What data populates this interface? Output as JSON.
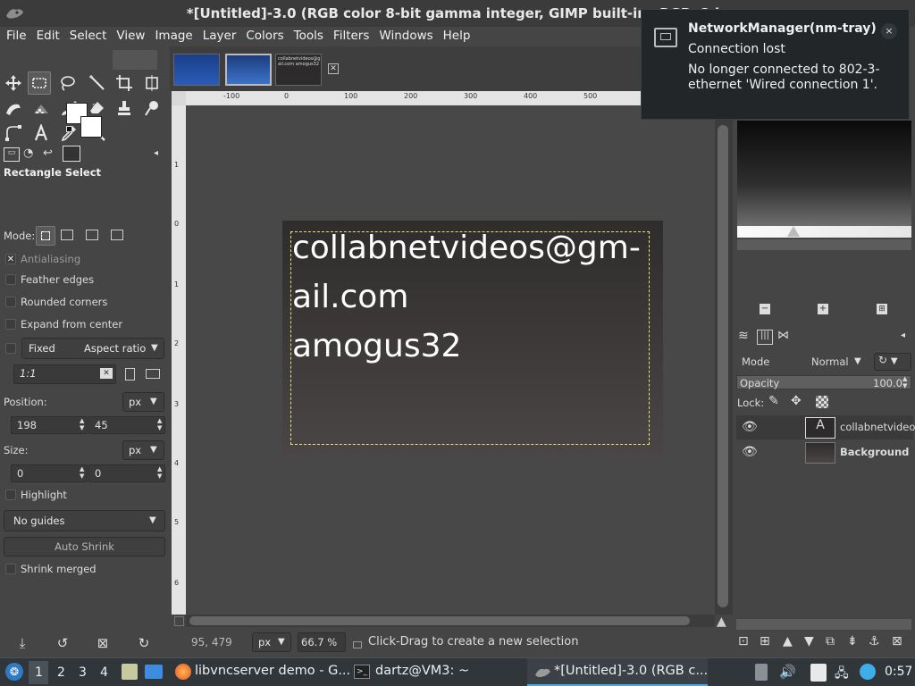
{
  "window": {
    "title": "*[Untitled]-3.0 (RGB color 8-bit gamma integer, GIMP built-in sRGB, 2 la"
  },
  "menubar": [
    "File",
    "Edit",
    "Select",
    "View",
    "Image",
    "Layer",
    "Colors",
    "Tools",
    "Filters",
    "Windows",
    "Help"
  ],
  "tool_options": {
    "title": "Rectangle Select",
    "mode_label": "Mode:",
    "antialiasing": "Antialiasing",
    "feather_edges": "Feather edges",
    "rounded_corners": "Rounded corners",
    "expand_from_center": "Expand from center",
    "fixed_label": "Fixed",
    "fixed_mode": "Aspect ratio",
    "ratio_value": "1:1",
    "position_label": "Position:",
    "position_unit": "px",
    "position_x": "198",
    "position_y": "45",
    "size_label": "Size:",
    "size_unit": "px",
    "size_w": "0",
    "size_h": "0",
    "highlight": "Highlight",
    "guides": "No guides",
    "auto_shrink": "Auto Shrink",
    "shrink_merged": "Shrink merged"
  },
  "image_thumbs": {
    "third_text": "collabnetvideos@gm-ail.com amogus32"
  },
  "ruler_labels": {
    "h": [
      "-100",
      "0",
      "100",
      "200",
      "300",
      "400",
      "500"
    ],
    "v": [
      "1",
      "0",
      "1",
      "2",
      "3",
      "4",
      "5",
      "6"
    ]
  },
  "canvas_text": {
    "line1": "collabnetvideos@gm-",
    "line2": "ail.com",
    "line3": "amogus32"
  },
  "status": {
    "coords": "95, 479",
    "unit": "px",
    "zoom": "66.7 %",
    "message": "Click-Drag to create a new selection"
  },
  "layers": {
    "mode_label": "Mode",
    "mode_value": "Normal",
    "opacity_label": "Opacity",
    "opacity_value": "100.0",
    "lock_label": "Lock:",
    "items": [
      {
        "name": "collabnetvideo"
      },
      {
        "name": "Background"
      }
    ]
  },
  "notification": {
    "title": "NetworkManager(nm-tray)",
    "subtitle": "Connection lost",
    "body": "No longer connected to 802-3-ethernet 'Wired connection 1'.",
    "close": "×"
  },
  "taskbar": {
    "workspaces": [
      "1",
      "2",
      "3",
      "4"
    ],
    "tasks": [
      {
        "label": "libvncserver demo - G..."
      },
      {
        "label": "dartz@VM3: ~"
      },
      {
        "label": "*[Untitled]-3.0 (RGB c..."
      }
    ],
    "clock": "0:57"
  },
  "colors": {
    "ui_bg": "#454545",
    "selection": "#e9e27a",
    "taskbar_bg": "#31363b",
    "notification_bg": "#232629"
  }
}
